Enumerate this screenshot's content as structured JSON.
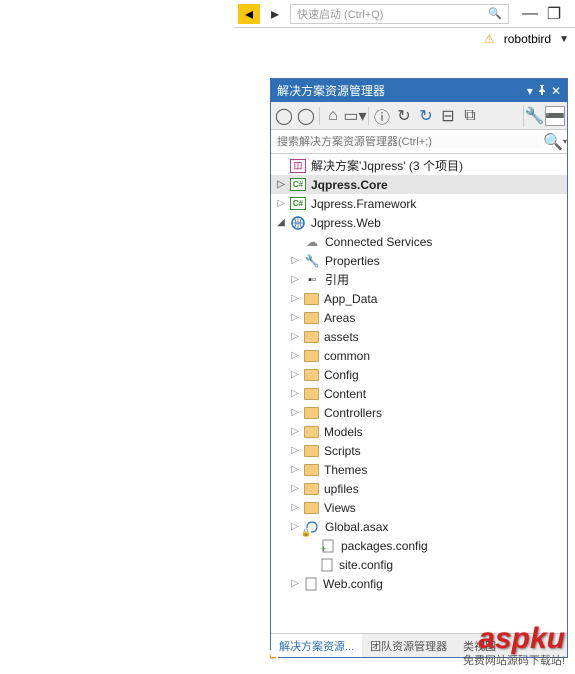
{
  "topbar": {
    "quicklaunch_placeholder": "快速启动 (Ctrl+Q)"
  },
  "user": {
    "name": "robotbird"
  },
  "panel": {
    "title": "解决方案资源管理器"
  },
  "search": {
    "placeholder": "搜索解决方案资源管理器(Ctrl+;)"
  },
  "tree": {
    "solution": "解决方案'Jqpress' (3 个项目)",
    "core": "Jqpress.Core",
    "framework": "Jqpress.Framework",
    "web": "Jqpress.Web",
    "connected": "Connected Services",
    "properties": "Properties",
    "references": "引用",
    "folders": {
      "appdata": "App_Data",
      "areas": "Areas",
      "assets": "assets",
      "common": "common",
      "config": "Config",
      "content": "Content",
      "controllers": "Controllers",
      "models": "Models",
      "scripts": "Scripts",
      "themes": "Themes",
      "upfiles": "upfiles",
      "views": "Views"
    },
    "files": {
      "global": "Global.asax",
      "packages": "packages.config",
      "site": "site.config",
      "web": "Web.config"
    }
  },
  "footer": {
    "active": "解决方案资源...",
    "team": "团队资源管理器",
    "class": "类视图"
  },
  "watermark": {
    "logo": "aspku",
    "sub": "免费网站源码下载站!"
  }
}
